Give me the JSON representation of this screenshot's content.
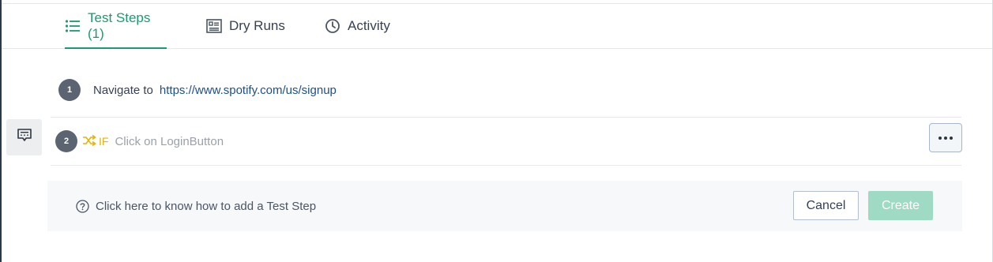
{
  "tabs": [
    {
      "label": "Test Steps (1)",
      "icon": "list-icon",
      "active": true
    },
    {
      "label": "Dry Runs",
      "icon": "report-icon",
      "active": false
    },
    {
      "label": "Activity",
      "icon": "clock-icon",
      "active": false
    }
  ],
  "steps": [
    {
      "number": "1",
      "action": "Navigate to",
      "url": "https://www.spotify.com/us/signup"
    },
    {
      "number": "2",
      "condition": "IF",
      "condition_icon": "shuffle-icon",
      "action": "Click on LoginButton"
    }
  ],
  "side_button": {
    "icon": "comment-icon"
  },
  "more_button": {
    "icon": "more-dots-icon"
  },
  "footer": {
    "help_text": "Click here to know how to add a Test Step",
    "help_icon": "question-circle-icon",
    "cancel_label": "Cancel",
    "create_label": "Create"
  },
  "colors": {
    "accent": "#1a9b6d",
    "create_disabled": "#9fdac4",
    "condition": "#e5b300",
    "link": "#1e4f8a",
    "step_badge": "#5b6470"
  }
}
